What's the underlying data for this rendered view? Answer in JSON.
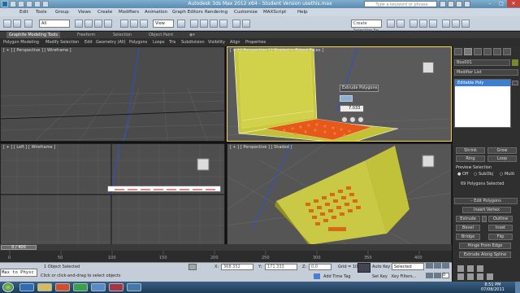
{
  "window": {
    "title": "Autodesk 3ds Max  2012 x64  - Student Version   usethis.max",
    "help_search_placeholder": "Type a keyword or phrase",
    "controls": [
      "–",
      "□",
      "✕"
    ]
  },
  "menu": [
    "Edit",
    "Tools",
    "Group",
    "Views",
    "Create",
    "Modifiers",
    "Animation",
    "Graph Editors",
    "Rendering",
    "Customize",
    "MAXScript",
    "Help"
  ],
  "toolbar": {
    "selection_filter": "All",
    "reference_coord": "View",
    "named_selection_set": "Create Selection Se"
  },
  "ribbon": {
    "tabs": [
      "Graphite Modeling Tools",
      "Freeform",
      "Selection",
      "Object Paint"
    ],
    "panels": [
      "Polygon Modeling",
      "Modify Selection",
      "Edit",
      "Geometry (All)",
      "Polygons",
      "Loops",
      "Tris",
      "Subdivision",
      "Visibility",
      "Align",
      "Properties"
    ]
  },
  "viewports": {
    "persp_wire": {
      "label": "[ + ] [ Perspective ] [ Wireframe ]"
    },
    "persp_shaded_edged": {
      "label": "[ + ] [ Perspective ] [ Shaded + Edged Faces ]",
      "caddy_title": "Extrude Polygons",
      "caddy_value": "7.033"
    },
    "left_wire": {
      "label": "[ + ] [ Left ] [ Wireframe ]"
    },
    "persp_shaded": {
      "label": "[ + ] [ Perspective ] [ Shaded ]"
    }
  },
  "timeline": {
    "slider": "0 / 400",
    "ticks": [
      "0",
      "50",
      "100",
      "150",
      "200",
      "250",
      "300",
      "350",
      "400"
    ]
  },
  "command_panel": {
    "object_name": "Box001",
    "modifier_list": "Modifier List",
    "stack_item": "Editable Poly",
    "soft_selection": {
      "shrink": "Shrink",
      "grow": "Grow",
      "ring": "Ring",
      "loop": "Loop"
    },
    "preview_selection": {
      "title": "Preview Selection",
      "off": "Off",
      "subobj": "SubObj",
      "multi": "Multi"
    },
    "selected_count": "69 Polygons Selected",
    "edit_polygons": {
      "title": "Edit Polygons",
      "insert_vertex": "Insert Vertex",
      "extrude": "Extrude",
      "outline": "Outline",
      "bevel": "Bevel",
      "inset": "Inset",
      "bridge": "Bridge",
      "flip": "Flip",
      "hinge": "Hinge From Edge",
      "extrude_spline": "Extrude Along Spline"
    }
  },
  "status": {
    "maxscript": "Max to Physc",
    "objects_selected": "1 Object Selected",
    "prompt": "Click or click-and-drag to select objects",
    "x_label": "X:",
    "x_value": "368.352",
    "y_label": "Y:",
    "y_value": "171.333",
    "z_label": "Z:",
    "z_value": "0.0",
    "grid": "Grid = 10.0",
    "add_time_tag": "Add Time Tag",
    "auto_key": "Auto Key",
    "auto_key_value": "Selected",
    "set_key": "Set Key",
    "key_filters": "Key Filters...",
    "frame": "0"
  },
  "taskbar": {
    "time": "8:51 PM",
    "date": "07/08/2011"
  }
}
